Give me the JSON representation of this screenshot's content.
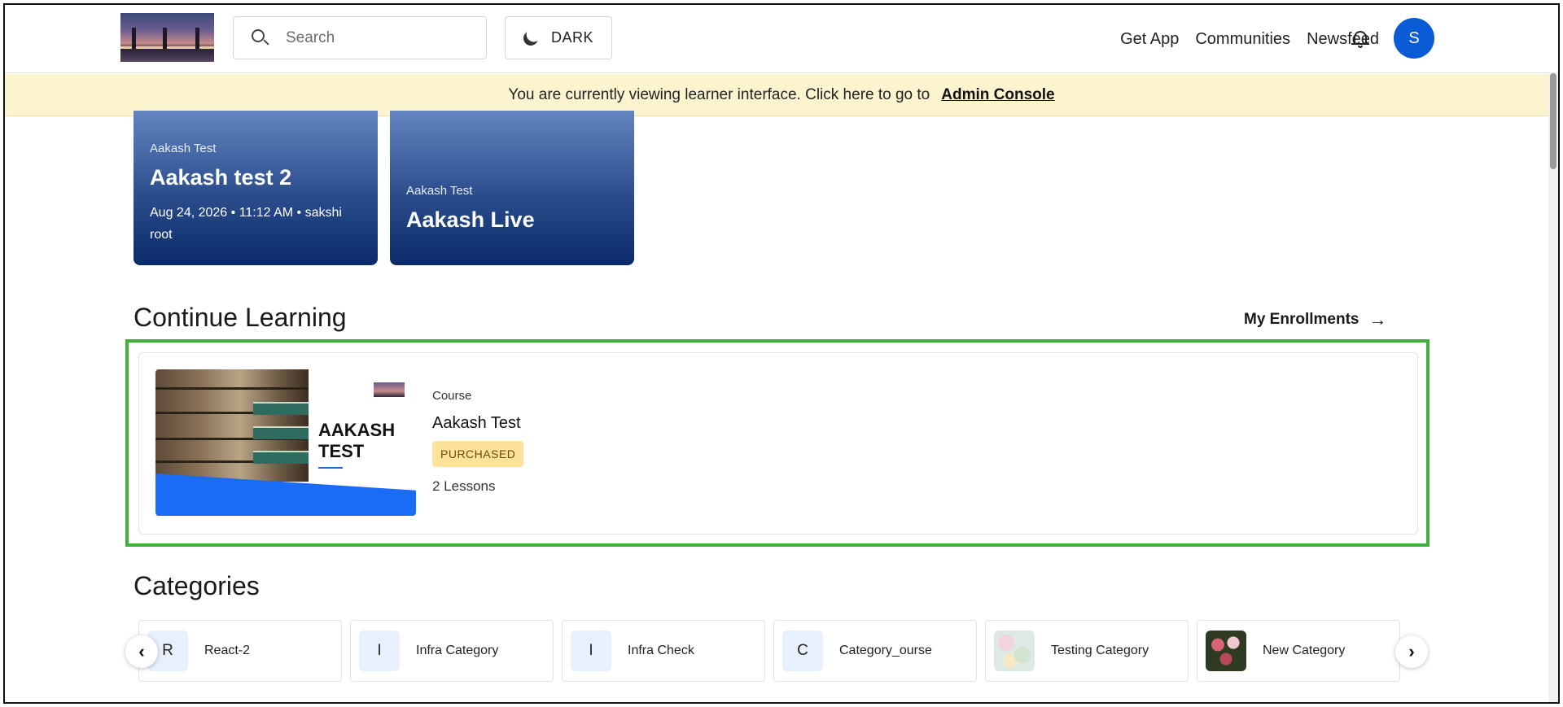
{
  "header": {
    "search_placeholder": "Search",
    "theme_button": "DARK",
    "nav": [
      "Get App",
      "Communities",
      "Newsfeed"
    ],
    "avatar_initial": "S"
  },
  "banner": {
    "text": "You are currently viewing learner interface. Click here to go to",
    "link": "Admin Console"
  },
  "live_sessions": [
    {
      "tag": "Aakash Test",
      "title": "Aakash test 2",
      "meta": "Aug 24, 2026 • 11:12 AM • sakshi root"
    },
    {
      "tag": "Aakash Test",
      "title": "Aakash Live",
      "meta": ""
    }
  ],
  "continue_learning": {
    "title": "Continue Learning",
    "enrollments_link": "My Enrollments",
    "course": {
      "thumb_title_line1": "AAKASH",
      "thumb_title_line2": "TEST",
      "type": "Course",
      "name": "Aakash Test",
      "badge": "PURCHASED",
      "lessons": "2 Lessons"
    }
  },
  "categories": {
    "title": "Categories",
    "items": [
      {
        "letter": "R",
        "label": "React-2"
      },
      {
        "letter": "I",
        "label": "Infra Category"
      },
      {
        "letter": "I",
        "label": "Infra Check"
      },
      {
        "letter": "C",
        "label": "Category_ourse"
      },
      {
        "letter": "",
        "label": "Testing Category"
      },
      {
        "letter": "",
        "label": "New Category"
      }
    ]
  },
  "colors": {
    "accent": "#0a5bd6",
    "highlight": "#3fb13a",
    "banner": "#fcf3cf",
    "badge": "#fde29a"
  }
}
